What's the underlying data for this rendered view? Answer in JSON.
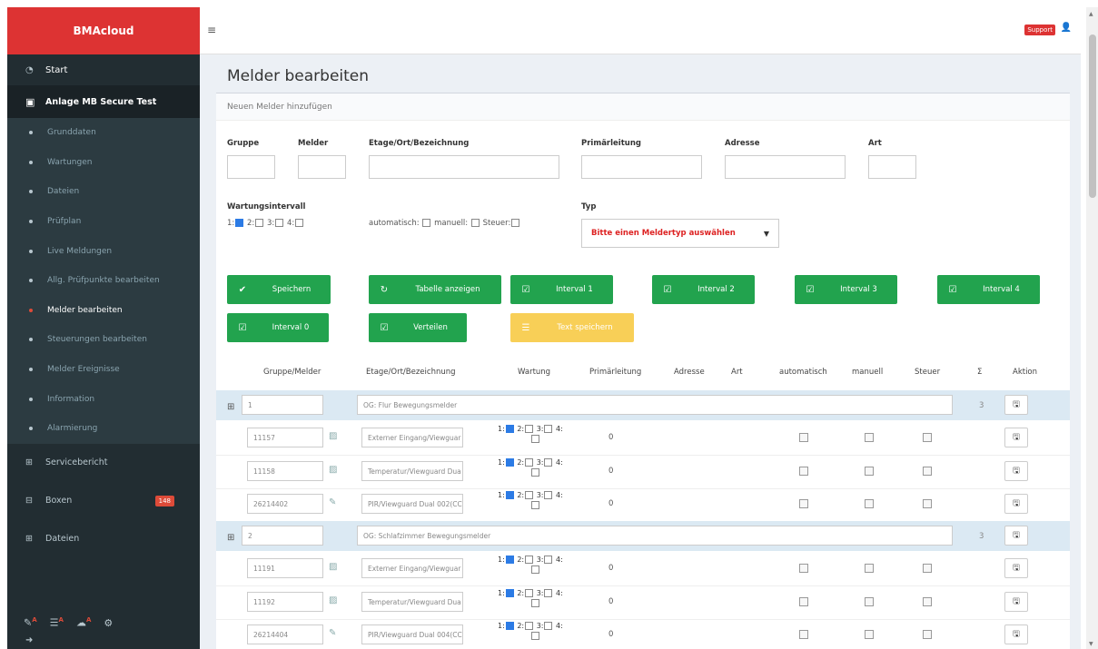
{
  "brand": "BMAcloud",
  "sidebar": {
    "start": "Start",
    "anlage": "Anlage MB Secure Test",
    "subitems": [
      {
        "label": "Grunddaten"
      },
      {
        "label": "Wartungen"
      },
      {
        "label": "Dateien"
      },
      {
        "label": "Prüfplan"
      },
      {
        "label": "Live Meldungen"
      },
      {
        "label": "Allg. Prüfpunkte bearbeiten"
      },
      {
        "label": "Melder bearbeiten"
      },
      {
        "label": "Steuerungen bearbeiten"
      },
      {
        "label": "Melder Ereignisse"
      },
      {
        "label": "Information"
      },
      {
        "label": "Alarmierung"
      }
    ],
    "servicebericht": "Servicebericht",
    "boxen": "Boxen",
    "boxen_badge": "148",
    "dateien": "Dateien",
    "footer_marker": "A"
  },
  "topbar": {
    "support": "Support"
  },
  "page": {
    "title": "Melder bearbeiten",
    "box_header": "Neuen Melder hinzufügen"
  },
  "form": {
    "gruppe": "Gruppe",
    "melder": "Melder",
    "etage": "Etage/Ort/Bezeichnung",
    "primaer": "Primärleitung",
    "adresse": "Adresse",
    "art": "Art",
    "wartungsintervall": "Wartungsintervall",
    "w1": "1:",
    "w2": "2:",
    "w3": "3:",
    "w4": "4:",
    "automatisch": "automatisch:",
    "manuell": "manuell:",
    "steuer": "Steuer:",
    "typ": "Typ",
    "typ_placeholder": "Bitte einen Meldertyp auswählen"
  },
  "buttons": {
    "speichern": "Speichern",
    "tabelle": "Tabelle anzeigen",
    "interval1": "Interval 1",
    "interval2": "Interval 2",
    "interval3": "Interval 3",
    "interval4": "Interval 4",
    "interval0": "Interval 0",
    "verteilen": "Verteilen",
    "text_speichern": "Text speichern"
  },
  "table": {
    "headers": {
      "gruppe_melder": "Gruppe/Melder",
      "etage": "Etage/Ort/Bezeichnung",
      "wartung": "Wartung",
      "primaer": "Primärleitung",
      "adresse": "Adresse",
      "art": "Art",
      "automatisch": "automatisch",
      "manuell": "manuell",
      "steuer": "Steuer",
      "sum": "Σ",
      "aktion": "Aktion"
    },
    "groups": [
      {
        "gruppe": "1",
        "bezeichnung": "OG: Flur Bewegungsmelder",
        "sum": "3",
        "rows": [
          {
            "melder": "11157",
            "bezeichnung": "Externer Eingang/Viewguar",
            "primaer": "0"
          },
          {
            "melder": "11158",
            "bezeichnung": "Temperatur/Viewguard Dua",
            "primaer": "0"
          },
          {
            "melder": "26214402",
            "bezeichnung": "PIR/Viewguard Dual 002(CC",
            "primaer": "0"
          }
        ]
      },
      {
        "gruppe": "2",
        "bezeichnung": "OG: Schlafzimmer Bewegungsmelder",
        "sum": "3",
        "rows": [
          {
            "melder": "11191",
            "bezeichnung": "Externer Eingang/Viewguar",
            "primaer": "0"
          },
          {
            "melder": "11192",
            "bezeichnung": "Temperatur/Viewguard Dua",
            "primaer": "0"
          },
          {
            "melder": "26214404",
            "bezeichnung": "PIR/Viewguard Dual 004(CC",
            "primaer": "0"
          }
        ]
      }
    ],
    "wartung_labels": {
      "w1": "1:",
      "w2": "2:",
      "w3": "3:",
      "w4": "4:"
    }
  },
  "colors": {
    "brand_red": "#dd3333",
    "sidebar_bg": "#222d32",
    "success_green": "#22a34e",
    "warning_yellow": "#f8cf57",
    "group_row_bg": "#dbe9f3"
  }
}
